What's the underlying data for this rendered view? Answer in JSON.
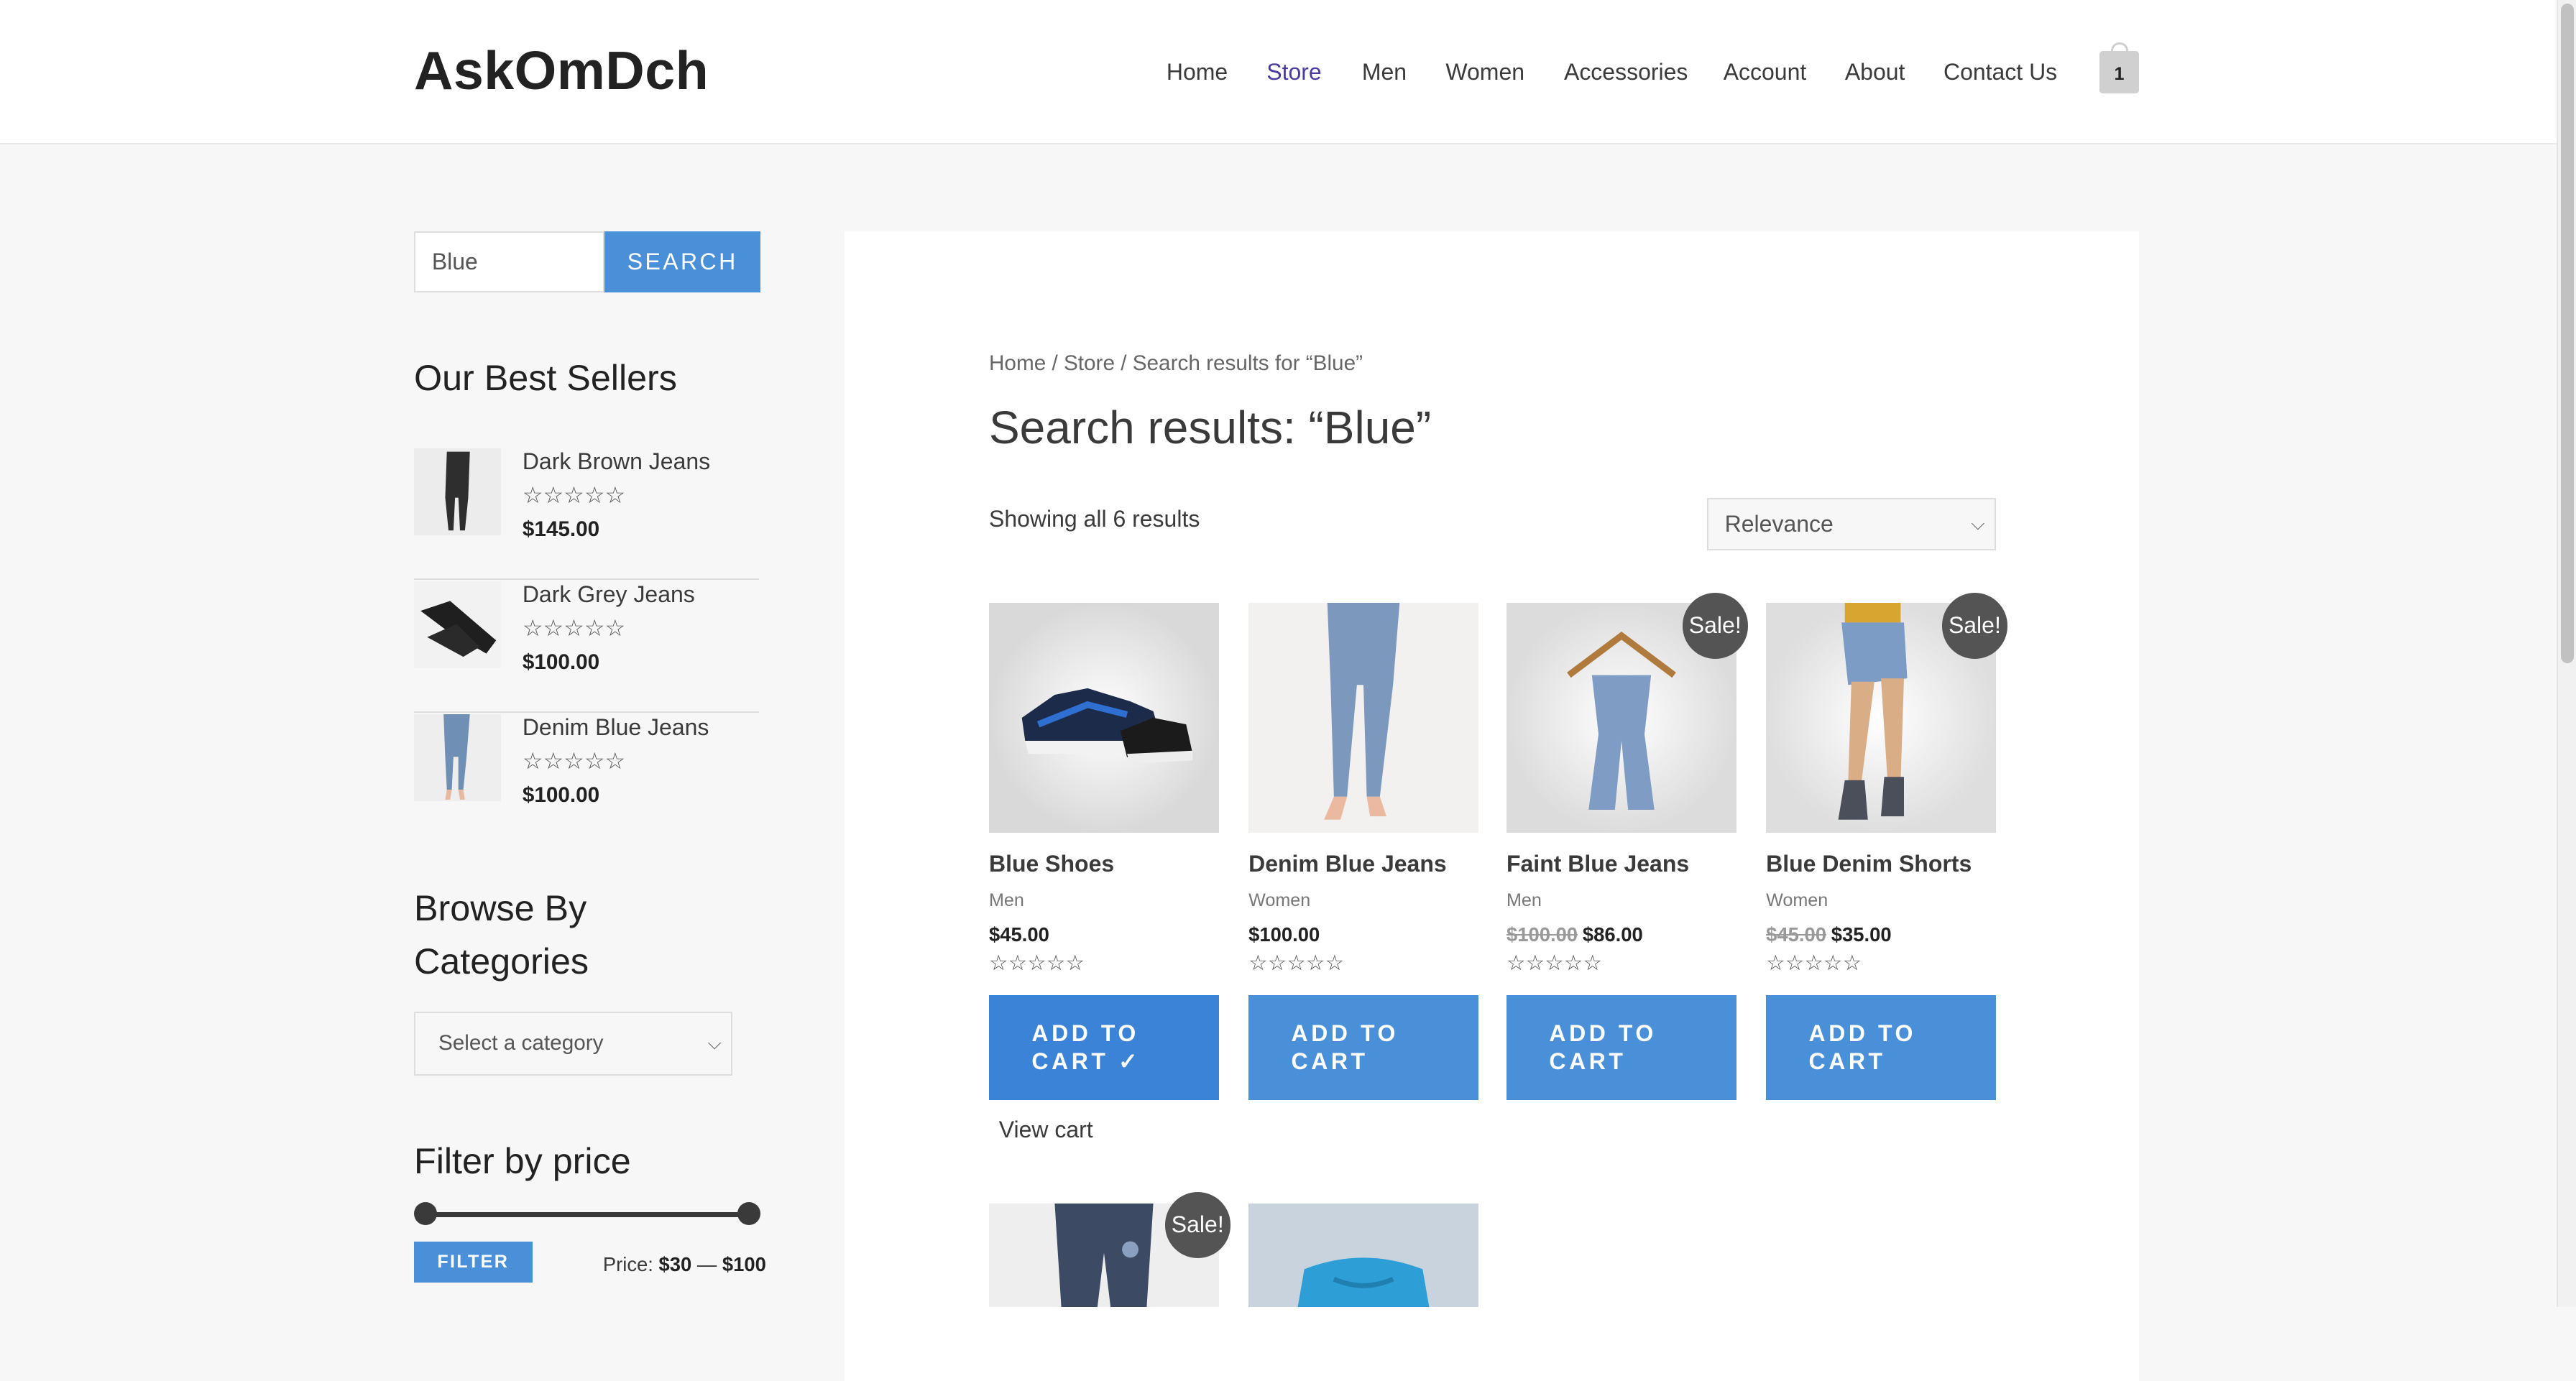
{
  "header": {
    "logo": "AskOmDch",
    "nav": [
      {
        "label": "Home"
      },
      {
        "label": "Store"
      },
      {
        "label": "Men"
      },
      {
        "label": "Women"
      },
      {
        "label": "Accessories"
      },
      {
        "label": "Account"
      },
      {
        "label": "About"
      },
      {
        "label": "Contact Us"
      }
    ],
    "cart_count": "1"
  },
  "sidebar": {
    "search": {
      "value": "Blue",
      "button": "SEARCH"
    },
    "best_sellers": {
      "title": "Our Best Sellers",
      "items": [
        {
          "name": "Dark Brown Jeans",
          "stars": "☆☆☆☆☆",
          "price": "$145.00"
        },
        {
          "name": "Dark Grey Jeans",
          "stars": "☆☆☆☆☆",
          "price": "$100.00"
        },
        {
          "name": "Denim Blue Jeans",
          "stars": "☆☆☆☆☆",
          "price": "$100.00"
        }
      ]
    },
    "categories": {
      "title": "Browse By Categories",
      "select_value": "Select a category"
    },
    "filter": {
      "title": "Filter by price",
      "button": "FILTER",
      "label": "Price:",
      "min": "$30",
      "dash": "—",
      "max": "$100"
    }
  },
  "main": {
    "breadcrumb": "Home / Store / Search results for “Blue”",
    "title": "Search results: “Blue”",
    "result_count": "Showing all 6 results",
    "orderby": "Relevance",
    "products": [
      {
        "title": "Blue Shoes",
        "category": "Men",
        "old_price": "",
        "price": "$45.00",
        "stars": "☆☆☆☆☆",
        "button": "ADD TO CART ✓",
        "sale": ""
      },
      {
        "title": "Denim Blue Jeans",
        "category": "Women",
        "old_price": "",
        "price": "$100.00",
        "stars": "☆☆☆☆☆",
        "button": "ADD TO CART",
        "sale": ""
      },
      {
        "title": "Faint Blue Jeans",
        "category": "Men",
        "old_price": "$100.00",
        "price": "$86.00",
        "stars": "☆☆☆☆☆",
        "button": "ADD TO CART",
        "sale": "Sale!"
      },
      {
        "title": "Blue Denim Shorts",
        "category": "Women",
        "old_price": "$45.00",
        "price": "$35.00",
        "stars": "☆☆☆☆☆",
        "button": "ADD TO CART",
        "sale": "Sale!"
      }
    ],
    "second_row_sale": "Sale!",
    "view_cart": "View cart"
  }
}
